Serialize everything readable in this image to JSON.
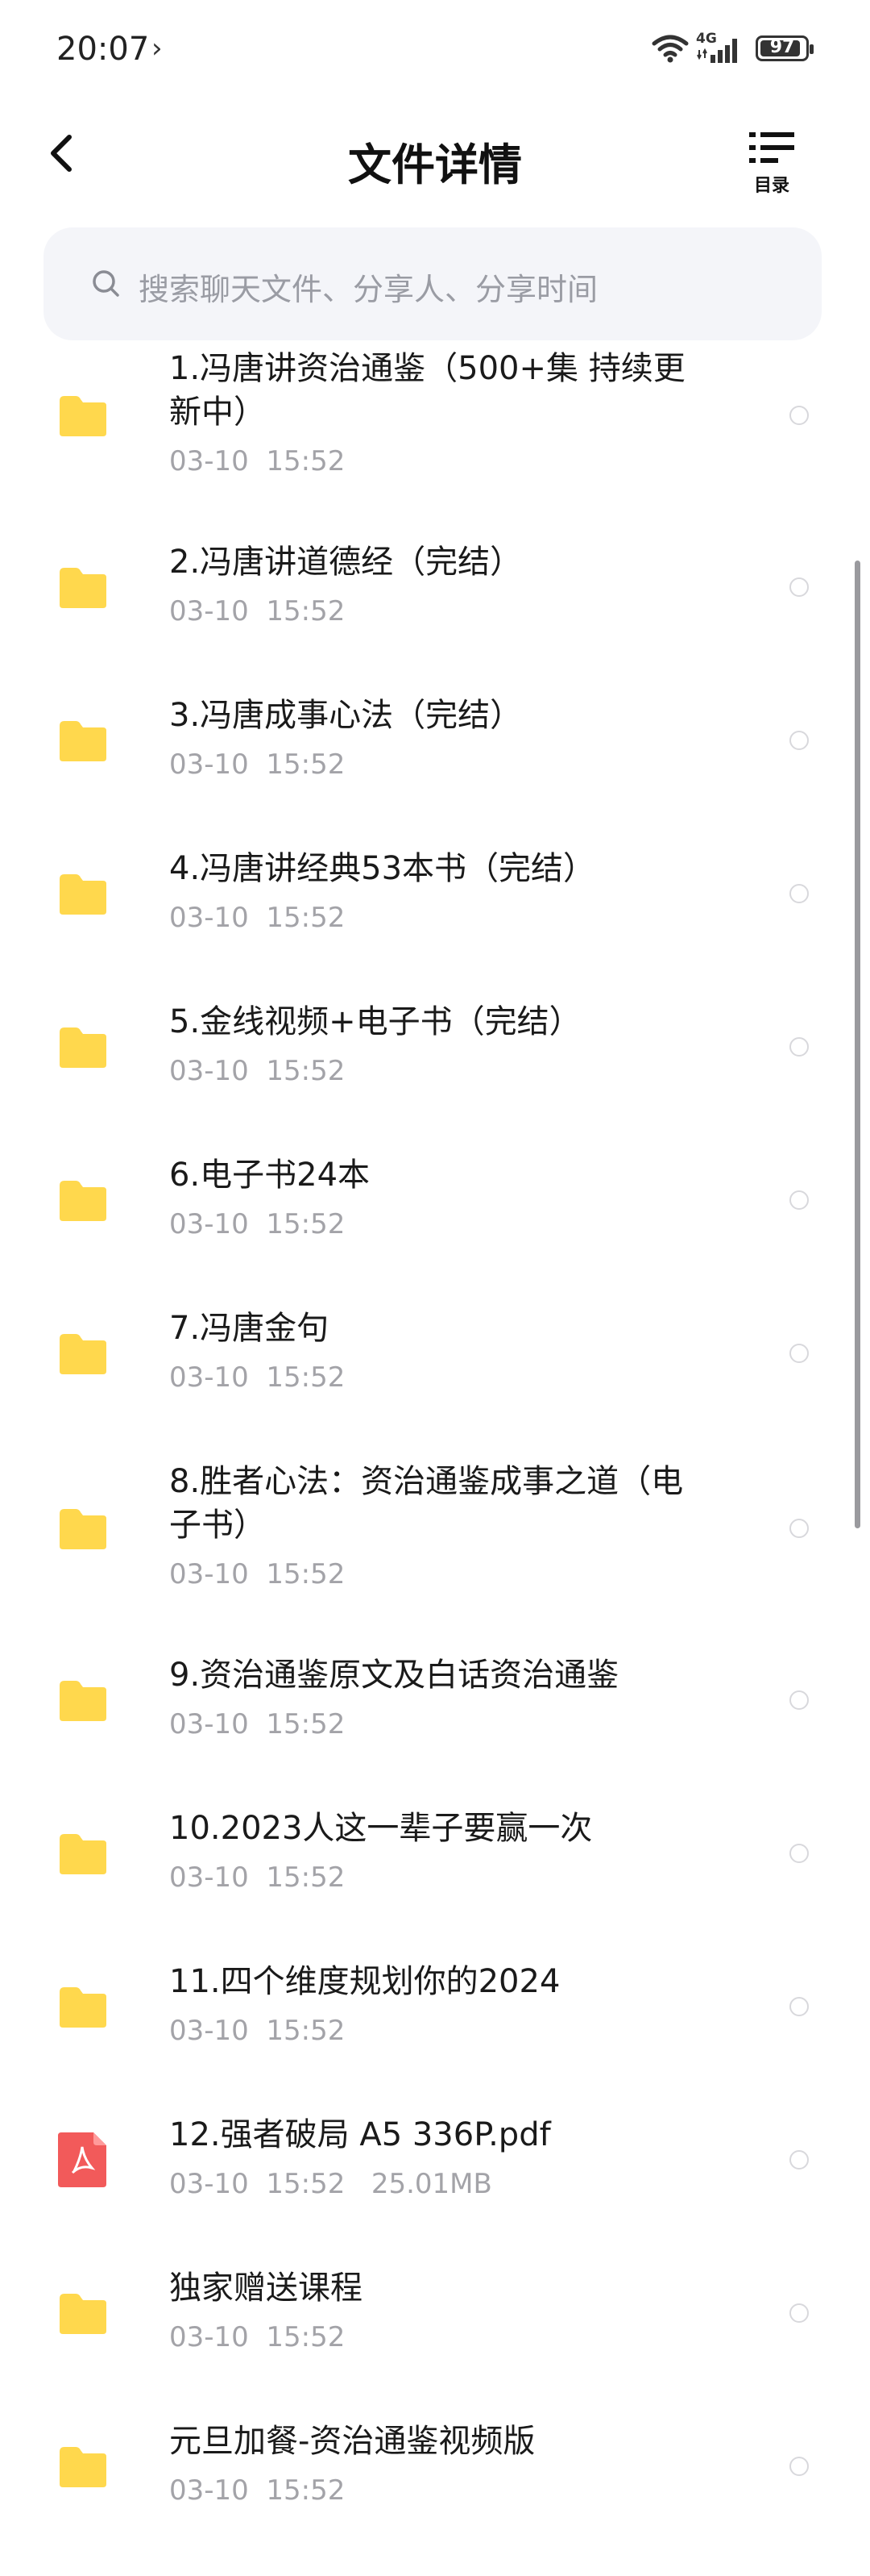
{
  "status_bar": {
    "time": "20:07",
    "arrow": "›",
    "network": "4G",
    "battery": "97"
  },
  "header": {
    "title": "文件详情",
    "toc_label": "目录"
  },
  "search": {
    "placeholder": "搜索聊天文件、分享人、分享时间"
  },
  "files": [
    {
      "name": "1.冯唐讲资治通鉴（500+集 持续更新中）",
      "meta": "03-10  15:52",
      "type": "folder"
    },
    {
      "name": "2.冯唐讲道德经（完结）",
      "meta": "03-10  15:52",
      "type": "folder"
    },
    {
      "name": "3.冯唐成事心法（完结）",
      "meta": "03-10  15:52",
      "type": "folder"
    },
    {
      "name": "4.冯唐讲经典53本书（完结）",
      "meta": "03-10  15:52",
      "type": "folder"
    },
    {
      "name": "5.金线视频+电子书（完结）",
      "meta": "03-10  15:52",
      "type": "folder"
    },
    {
      "name": "6.电子书24本",
      "meta": "03-10  15:52",
      "type": "folder"
    },
    {
      "name": "7.冯唐金句",
      "meta": "03-10  15:52",
      "type": "folder"
    },
    {
      "name": "8.胜者心法：资治通鉴成事之道（电子书）",
      "meta": "03-10  15:52",
      "type": "folder"
    },
    {
      "name": "9.资治通鉴原文及白话资治通鉴",
      "meta": "03-10  15:52",
      "type": "folder"
    },
    {
      "name": "10.2023人这一辈子要赢一次",
      "meta": "03-10  15:52",
      "type": "folder"
    },
    {
      "name": "11.四个维度规划你的2024",
      "meta": "03-10  15:52",
      "type": "folder"
    },
    {
      "name": "12.强者破局 A5 336P.pdf",
      "meta": "03-10  15:52   25.01MB",
      "type": "pdf"
    },
    {
      "name": "独家赠送课程",
      "meta": "03-10  15:52",
      "type": "folder"
    },
    {
      "name": "元旦加餐-资治通鉴视频版",
      "meta": "03-10  15:52",
      "type": "folder"
    }
  ],
  "colors": {
    "folder": "#FFD84D",
    "pdf": "#F25A5A",
    "accent_text": "#1a1a1a",
    "muted_text": "#a3a3a8"
  },
  "icons": {
    "folder": "folder-icon",
    "pdf": "pdf-icon",
    "back": "back-arrow-icon",
    "toc": "list-icon",
    "search": "search-icon"
  }
}
